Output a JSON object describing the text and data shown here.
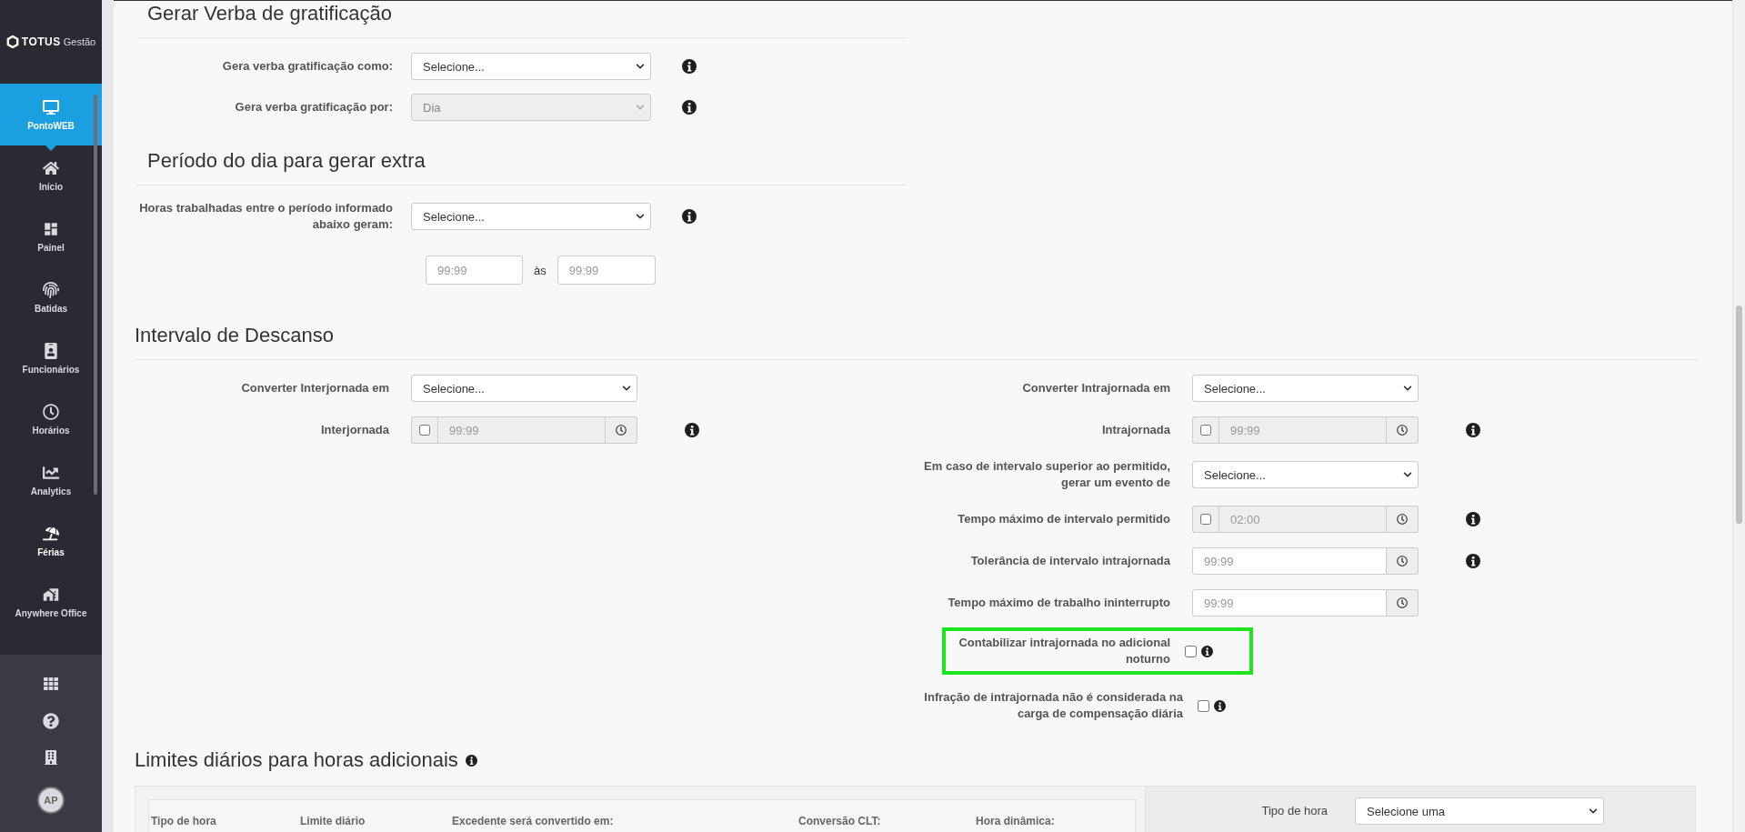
{
  "brand": {
    "name": "TOTUS",
    "suffix": "Gestão"
  },
  "sidebar": {
    "items": [
      {
        "label": "PontoWEB",
        "selected": true,
        "highlighted": false
      },
      {
        "label": "Início",
        "selected": false,
        "highlighted": false
      },
      {
        "label": "Painel",
        "selected": false,
        "highlighted": false
      },
      {
        "label": "Batidas",
        "selected": false,
        "highlighted": false
      },
      {
        "label": "Funcionários",
        "selected": false,
        "highlighted": false
      },
      {
        "label": "Horários",
        "selected": false,
        "highlighted": false
      },
      {
        "label": "Analytics",
        "selected": false,
        "highlighted": false
      },
      {
        "label": "Férias",
        "selected": false,
        "highlighted": true
      },
      {
        "label": "Anywhere Office",
        "selected": false,
        "highlighted": false
      }
    ],
    "avatar": "AP"
  },
  "sections": [
    {
      "kind": "form",
      "title": "Gerar Verba de gratificação",
      "rows": [
        {
          "kind": "select",
          "label": "Gera verba gratificação como:",
          "value": "Selecione...",
          "disabled": false,
          "info": true
        },
        {
          "kind": "select",
          "label": "Gera verba gratificação por:",
          "value": "Dia",
          "disabled": true,
          "info": true
        }
      ]
    },
    {
      "kind": "form",
      "title": "Período do dia para gerar extra",
      "rows": [
        {
          "kind": "select",
          "label": "Horas trabalhadas entre o período informado abaixo geram:",
          "value": "Selecione...",
          "disabled": false,
          "info": true
        },
        {
          "kind": "range",
          "from_placeholder": "99:99",
          "separator": "às",
          "to_placeholder": "99:99"
        }
      ]
    },
    {
      "kind": "columns",
      "title": "Intervalo de Descanso",
      "columns": [
        [
          {
            "kind": "select",
            "label": "Converter Interjornada em",
            "value": "Selecione...",
            "disabled": false,
            "info": false
          },
          {
            "kind": "toggle_time",
            "label": "Interjornada",
            "checked": false,
            "disabled": true,
            "placeholder": "99:99",
            "info": true
          }
        ],
        [
          {
            "kind": "select",
            "label": "Converter Intrajornada em",
            "value": "Selecione...",
            "disabled": false,
            "info": false
          },
          {
            "kind": "toggle_time",
            "label": "Intrajornada",
            "checked": false,
            "disabled": true,
            "placeholder": "99:99",
            "info": true
          },
          {
            "kind": "select",
            "label": "Em caso de intervalo superior ao permitido, gerar um evento de",
            "value": "Selecione...",
            "disabled": false,
            "info": false
          },
          {
            "kind": "toggle_time",
            "label": "Tempo máximo de intervalo permitido",
            "checked": false,
            "disabled": true,
            "value": "02:00",
            "info": true
          },
          {
            "kind": "time",
            "label": "Tolerância de intervalo intrajornada",
            "disabled": false,
            "placeholder": "99:99",
            "info": true
          },
          {
            "kind": "time",
            "label": "Tempo máximo de trabalho ininterrupto",
            "disabled": false,
            "placeholder": "99:99",
            "info": false
          },
          {
            "kind": "checkbox",
            "label": "Contabilizar intrajornada no adicional noturno",
            "checked": false,
            "info": true,
            "highlighted": true
          },
          {
            "kind": "checkbox",
            "label": "Infração de intrajornada não é considerada na carga de compensação diária",
            "checked": false,
            "info": true,
            "highlighted": false
          }
        ]
      ]
    },
    {
      "kind": "limits",
      "title": "Limites diários para horas adicionais",
      "info": true,
      "table": {
        "columns": [
          "Tipo de hora",
          "Limite diário",
          "Excedente será convertido em:",
          "Conversão CLT:",
          "Hora dinâmica:"
        ]
      },
      "filter": {
        "label": "Tipo de hora",
        "value": "Selecione uma"
      }
    }
  ]
}
